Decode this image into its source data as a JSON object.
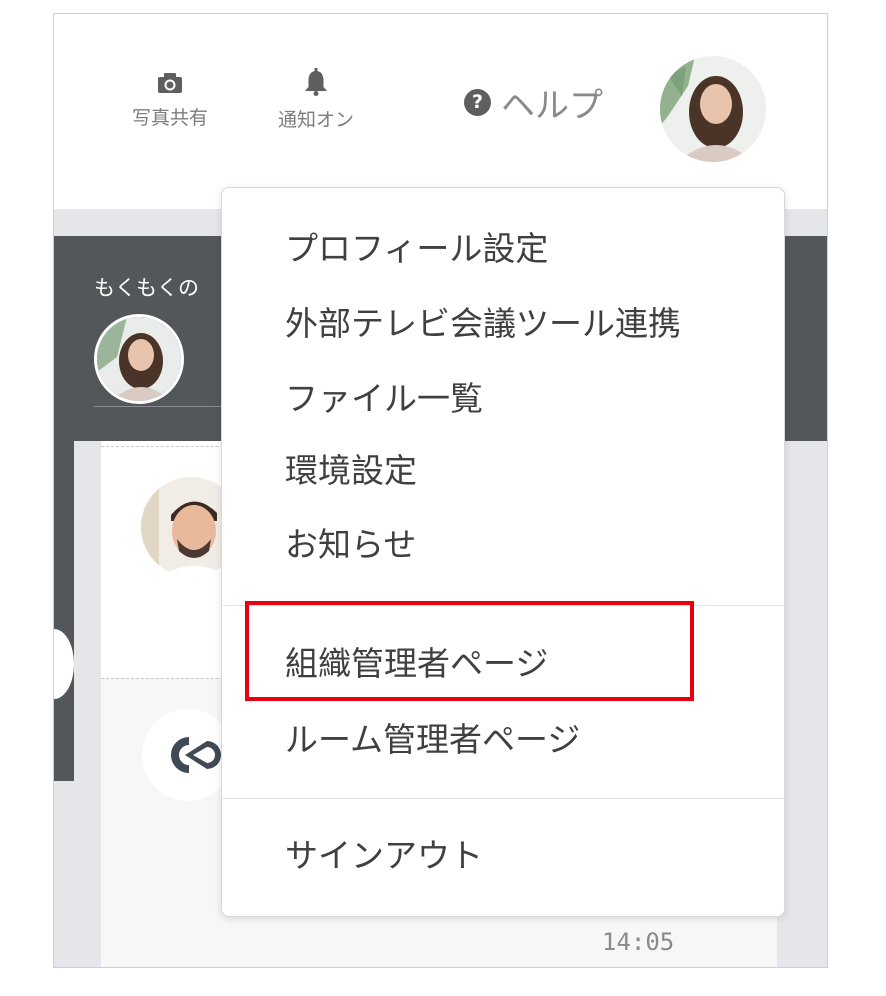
{
  "header": {
    "photo_share_label": "写真共有",
    "notification_label": "通知オン",
    "help_label": "ヘルプ",
    "help_icon_glyph": "?"
  },
  "room": {
    "title": "もくもくの"
  },
  "menu": {
    "items": [
      {
        "label": "プロフィール設定"
      },
      {
        "label": "外部テレビ会議ツール連携"
      },
      {
        "label": "ファイル一覧"
      },
      {
        "label": "環境設定"
      },
      {
        "label": "お知らせ"
      },
      {
        "label": "組織管理者ページ"
      },
      {
        "label": "ルーム管理者ページ"
      },
      {
        "label": "サインアウト"
      }
    ]
  },
  "message": {
    "time": "14:05"
  },
  "colors": {
    "highlight": "#e60012",
    "dark_panel": "#545759",
    "background_gray": "#e4e6e9"
  },
  "icons": [
    "camera-icon",
    "bell-icon",
    "help-icon",
    "user-avatar",
    "company-logo-icon"
  ]
}
